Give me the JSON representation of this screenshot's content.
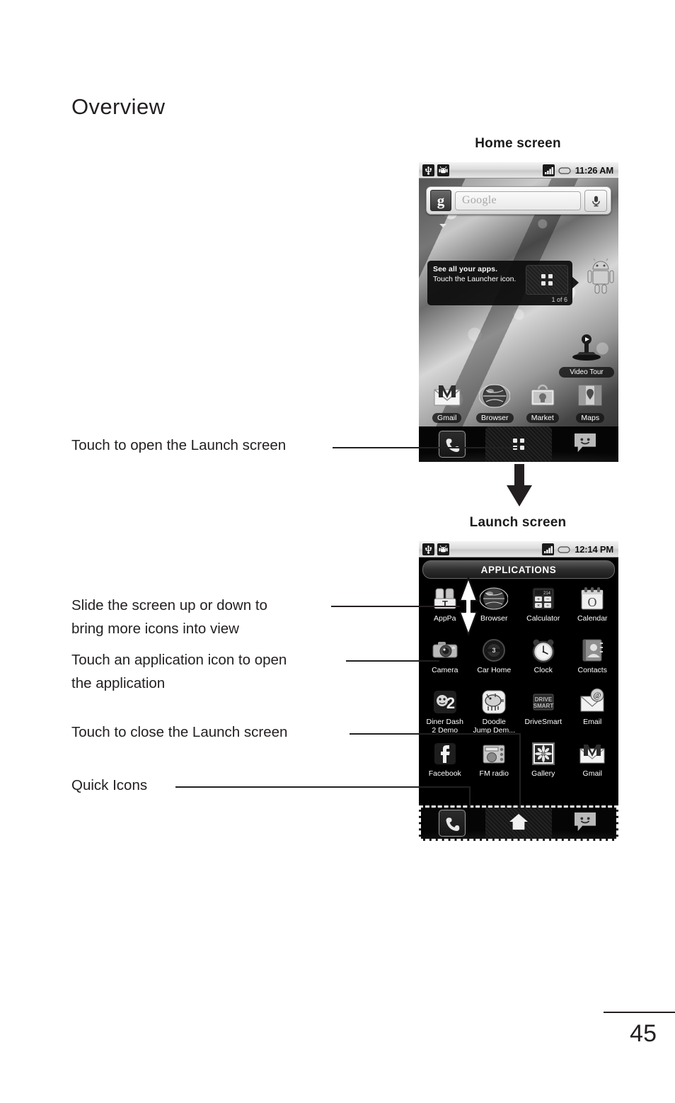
{
  "page": {
    "title": "Overview",
    "number": "45"
  },
  "sections": {
    "home": {
      "caption": "Home screen"
    },
    "launch": {
      "caption": "Launch screen"
    }
  },
  "annotations": [
    {
      "id": "open-launch",
      "text": "Touch to open the Launch screen"
    },
    {
      "id": "slide-screen",
      "text": "Slide the screen up or down to\nbring more icons into view"
    },
    {
      "id": "touch-app",
      "text": "Touch an application icon to open\nthe application"
    },
    {
      "id": "close-launch",
      "text": "Touch to close the Launch screen"
    },
    {
      "id": "quick-icons",
      "text": "Quick Icons"
    }
  ],
  "home_screen": {
    "status_bar": {
      "usb_icon": "usb-icon",
      "debug_icon": "android-bug-icon",
      "signal_icon": "signal-bars-icon",
      "battery_icon": "battery-icon",
      "time": "11:26 AM"
    },
    "search_widget": {
      "logo": "google-g-logo",
      "placeholder": "Google",
      "mic_icon": "microphone-icon"
    },
    "tooltip": {
      "title": "See all your apps.",
      "body": "Touch the Launcher\nicon.",
      "counter": "1 of 6",
      "launcher_icon": "launcher-grid-icon"
    },
    "widgets": [
      {
        "name": "video-tour",
        "label": "Video Tour",
        "icon": "video-tour-icon"
      }
    ],
    "mascot_icon": "android-mascot-icon",
    "apps": [
      {
        "label": "Gmail",
        "icon": "gmail-icon"
      },
      {
        "label": "Browser",
        "icon": "browser-globe-icon"
      },
      {
        "label": "Market",
        "icon": "market-bag-icon"
      },
      {
        "label": "Maps",
        "icon": "maps-icon"
      }
    ],
    "dock": [
      {
        "name": "phone",
        "icon": "phone-handset-icon"
      },
      {
        "name": "launcher",
        "icon": "launcher-grid-icon"
      },
      {
        "name": "messaging",
        "icon": "messaging-smiley-icon"
      }
    ]
  },
  "launch_screen": {
    "status_bar": {
      "usb_icon": "usb-icon",
      "debug_icon": "android-bug-icon",
      "signal_icon": "signal-bars-icon",
      "battery_icon": "battery-icon",
      "time": "12:14 PM"
    },
    "header": "APPLICATIONS",
    "apps": [
      {
        "label": "AppPa",
        "icon": "apppack-icon"
      },
      {
        "label": "Browser",
        "icon": "browser-globe-icon"
      },
      {
        "label": "Calculator",
        "icon": "calculator-icon"
      },
      {
        "label": "Calendar",
        "icon": "calendar-icon"
      },
      {
        "label": "Camera",
        "icon": "camera-icon"
      },
      {
        "label": "Car Home",
        "icon": "car-home-icon"
      },
      {
        "label": "Clock",
        "icon": "clock-icon"
      },
      {
        "label": "Contacts",
        "icon": "contacts-icon"
      },
      {
        "label": "Diner Dash\n2 Demo",
        "icon": "diner-dash-icon"
      },
      {
        "label": "Doodle\nJump Dem...",
        "icon": "doodle-jump-icon"
      },
      {
        "label": "DriveSmart",
        "icon": "drivesmart-icon"
      },
      {
        "label": "Email",
        "icon": "email-icon"
      },
      {
        "label": "Facebook",
        "icon": "facebook-icon"
      },
      {
        "label": "FM radio",
        "icon": "fm-radio-icon"
      },
      {
        "label": "Gallery",
        "icon": "gallery-icon"
      },
      {
        "label": "Gmail",
        "icon": "gmail-icon"
      }
    ],
    "dock": [
      {
        "name": "phone",
        "icon": "phone-handset-icon"
      },
      {
        "name": "home",
        "icon": "home-house-icon"
      },
      {
        "name": "messaging",
        "icon": "messaging-smiley-icon"
      }
    ],
    "scroll_hint_icon": "double-arrow-vertical-icon"
  },
  "flow_arrow_icon": "down-arrow-icon"
}
